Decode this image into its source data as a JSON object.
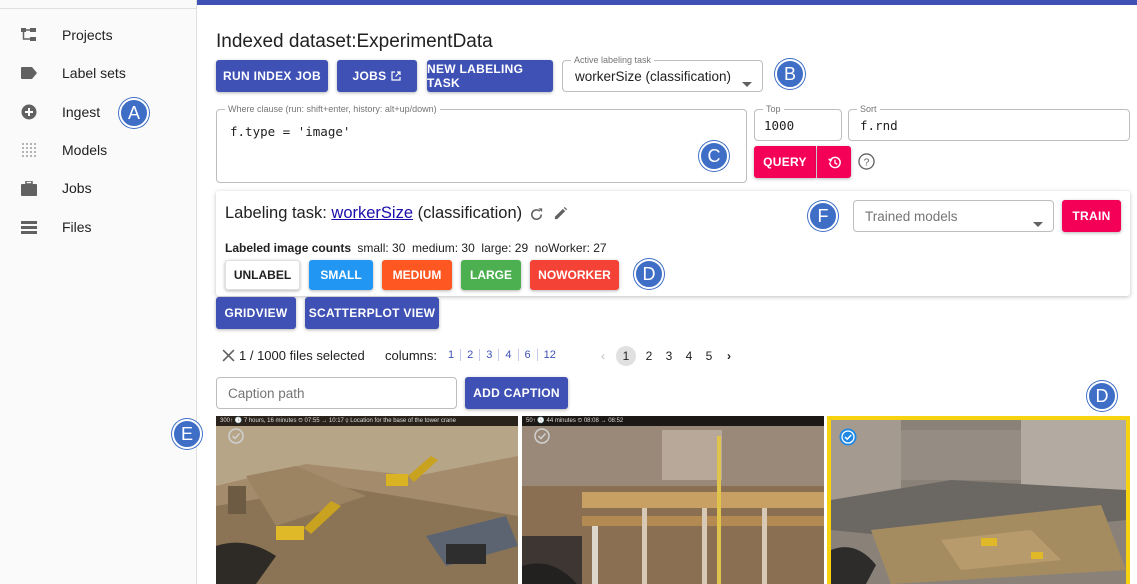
{
  "sidebar": {
    "items": [
      {
        "label": "Projects",
        "icon": "projects-icon"
      },
      {
        "label": "Label sets",
        "icon": "label-icon"
      },
      {
        "label": "Ingest",
        "icon": "add-circle-icon"
      },
      {
        "label": "Models",
        "icon": "grid-dots-icon"
      },
      {
        "label": "Jobs",
        "icon": "briefcase-icon"
      },
      {
        "label": "Files",
        "icon": "list-icon"
      }
    ]
  },
  "main": {
    "title": "Indexed dataset:ExperimentData",
    "buttons": {
      "run_index_job": "RUN INDEX JOB",
      "jobs": "JOBS",
      "new_labeling_task": "NEW LABELING TASK",
      "query": "QUERY",
      "gridview": "GRIDVIEW",
      "scatterplot_view": "SCATTERPLOT VIEW",
      "add_caption": "ADD CAPTION",
      "train": "TRAIN"
    },
    "active_task": {
      "label": "Active labeling task",
      "value": "workerSize (classification)"
    },
    "where": {
      "label": "Where clause (run: shift+enter, history: alt+up/down)",
      "value": "f.type = 'image'"
    },
    "top": {
      "label": "Top",
      "value": "1000"
    },
    "sort": {
      "label": "Sort",
      "value": "f.rnd"
    }
  },
  "labeling": {
    "prefix": "Labeling task: ",
    "task_name": "workerSize",
    "task_type": " (classification)",
    "counts_label": "Labeled image counts",
    "counts_text": "small: 30  medium: 30  large: 29  noWorker: 27",
    "trained_models_placeholder": "Trained models",
    "label_buttons": [
      {
        "label": "UNLABEL",
        "color": "#ffffff"
      },
      {
        "label": "SMALL",
        "color": "#2196f3"
      },
      {
        "label": "MEDIUM",
        "color": "#ff5722"
      },
      {
        "label": "LARGE",
        "color": "#4caf50"
      },
      {
        "label": "NOWORKER",
        "color": "#f44336"
      }
    ]
  },
  "selection": {
    "text": "1 / 1000 files selected",
    "columns_label": "columns:",
    "columns": [
      "1",
      "2",
      "3",
      "4",
      "6",
      "12"
    ],
    "pages": [
      "1",
      "2",
      "3",
      "4",
      "5"
    ]
  },
  "caption": {
    "placeholder": "Caption path"
  },
  "annotations": {
    "a": "A",
    "b": "B",
    "c": "C",
    "d1": "D",
    "d2": "D",
    "e": "E",
    "f": "F"
  },
  "thumbnails": [
    {
      "overlay": "300↑   🕓 7 hours, 16 minutes   ⏲ 07:55 → 10:17   ⚲ Location for the base of the tower crane",
      "selected": false
    },
    {
      "overlay": "50↑   🕓 44 minutes   ⏲ 08:08 → 08:52",
      "selected": false
    },
    {
      "overlay": "",
      "selected": true
    }
  ],
  "colors": {
    "primary": "#3f51b5",
    "accent": "#f50057",
    "annotation": "#3f6ec7",
    "selected_border": "#f6d20f"
  }
}
